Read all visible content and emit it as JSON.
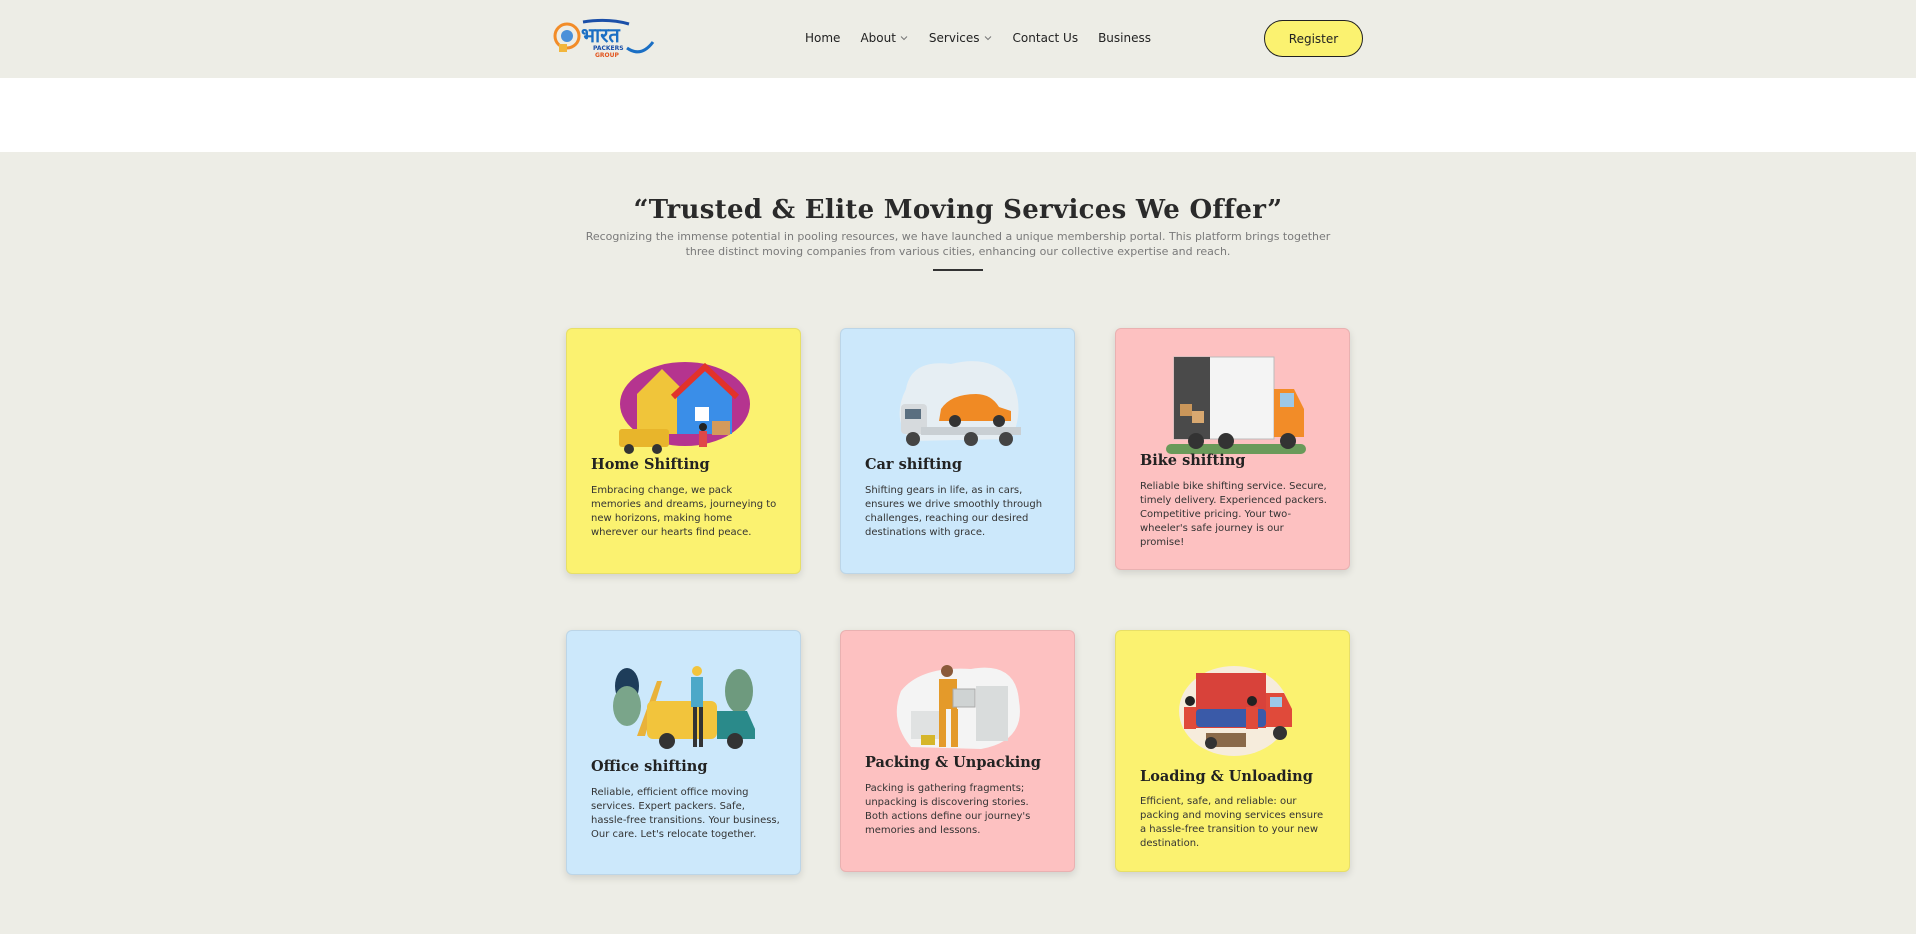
{
  "header": {
    "logo_text": "भारत",
    "logo_sub1": "PACKERS",
    "logo_sub2": "GROUP",
    "nav": [
      {
        "label": "Home",
        "dropdown": false
      },
      {
        "label": "About",
        "dropdown": true
      },
      {
        "label": "Services",
        "dropdown": true
      },
      {
        "label": "Contact Us",
        "dropdown": false
      },
      {
        "label": "Business",
        "dropdown": false
      }
    ],
    "register_label": "Register"
  },
  "section": {
    "title": "“Trusted & Elite Moving Services We Offer”",
    "subtitle": "Recognizing the immense potential in pooling resources, we have launched a unique membership portal. This platform brings together three distinct moving companies from various cities, enhancing our collective expertise and reach."
  },
  "cards": [
    {
      "title": "Home Shifting",
      "text": "Embracing change, we pack memories and dreams, journeying to new horizons, making home wherever our hearts find peace.",
      "color": "#fbf270",
      "icon": "house-moving-illustration"
    },
    {
      "title": "Car shifting",
      "text": "Shifting gears in life, as in cars, ensures we drive smoothly through challenges, reaching our desired destinations with grace.",
      "color": "#cce8fb",
      "icon": "car-carrier-illustration"
    },
    {
      "title": "Bike shifting",
      "text": "Reliable bike shifting service. Secure, timely delivery. Experienced packers. Competitive pricing. Your two-wheeler's safe journey is our promise!",
      "color": "#fdc1c1",
      "icon": "moving-truck-illustration"
    },
    {
      "title": "Office shifting",
      "text": "Reliable, efficient office moving services. Expert packers. Safe, hassle-free transitions. Your business, Our care. Let's relocate together.",
      "color": "#cce8fb",
      "icon": "office-move-illustration"
    },
    {
      "title": "Packing & Unpacking",
      "text": "Packing is gathering fragments; unpacking is discovering stories. Both actions define our journey's memories and lessons.",
      "color": "#fdc1c1",
      "icon": "packing-worker-illustration"
    },
    {
      "title": "Loading & Unloading",
      "text": "Efficient, safe, and reliable: our packing and moving services ensure a hassle-free transition to your new destination.",
      "color": "#fbf270",
      "icon": "loading-truck-illustration"
    }
  ]
}
